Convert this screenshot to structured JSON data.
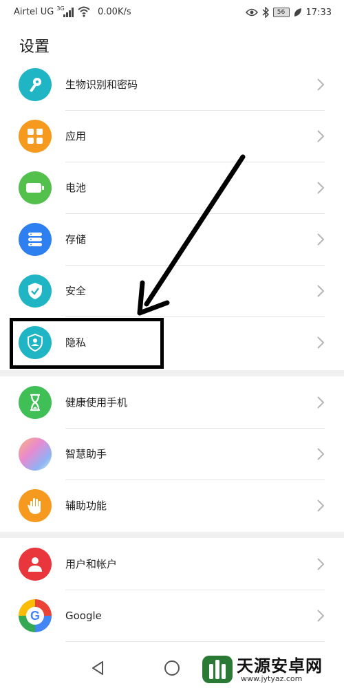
{
  "status_bar": {
    "carrier": "Airtel UG",
    "network_type": "3G",
    "speed": "0.00K/s",
    "battery": "56",
    "time": "17:33"
  },
  "page": {
    "title": "设置"
  },
  "settings": {
    "items": [
      {
        "label": "生物识别和密码",
        "icon": "key-icon",
        "color": "#1fb5c4"
      },
      {
        "label": "应用",
        "icon": "apps-grid-icon",
        "color": "#f59a1e"
      },
      {
        "label": "电池",
        "icon": "battery-icon",
        "color": "#52c04a"
      },
      {
        "label": "存储",
        "icon": "storage-icon",
        "color": "#2e7ff0"
      },
      {
        "label": "安全",
        "icon": "shield-check-icon",
        "color": "#1fb5c4"
      },
      {
        "label": "隐私",
        "icon": "privacy-shield-icon",
        "color": "#1fb5c4"
      },
      {
        "label": "健康使用手机",
        "icon": "hourglass-icon",
        "color": "#3fbf55"
      },
      {
        "label": "智慧助手",
        "icon": "assistant-icon",
        "color": "#d98ad9"
      },
      {
        "label": "辅助功能",
        "icon": "hand-icon",
        "color": "#f59a1e"
      },
      {
        "label": "用户和帐户",
        "icon": "user-icon",
        "color": "#e8363c"
      },
      {
        "label": "Google",
        "icon": "google-icon",
        "color": "#4285f4"
      }
    ]
  },
  "watermark": {
    "title": "天源安卓网",
    "url": "www.jytyaz.com"
  }
}
